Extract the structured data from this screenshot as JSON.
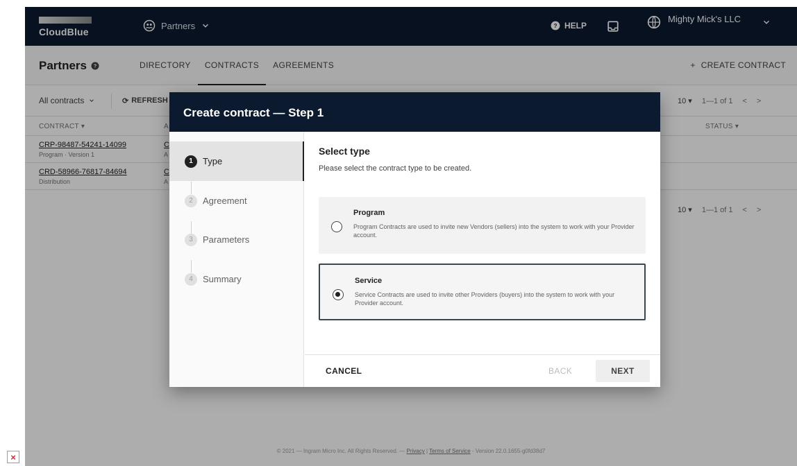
{
  "topbar": {
    "logo": "CloudBlue",
    "module": "Partners",
    "help": "HELP",
    "account": "Mighty Mick's LLC"
  },
  "subbar": {
    "title": "Partners",
    "tabs": [
      "DIRECTORY",
      "CONTRACTS",
      "AGREEMENTS"
    ],
    "active_tab": "CONTRACTS",
    "create": "CREATE CONTRACT"
  },
  "toolbar": {
    "filter": "All contracts",
    "refresh": "REFRESH",
    "page_size": "10",
    "range": "1—1 of 1"
  },
  "table": {
    "col_contract": "CONTRACT",
    "col_a": "A",
    "col_status": "STATUS",
    "rows": [
      {
        "id": "CRP-98487-54241-14099",
        "sub": "Program · Version 1",
        "c2": "C",
        "c2b": "A"
      },
      {
        "id": "CRD-58966-76817-84694",
        "sub": "Distribution",
        "c2": "C",
        "c2b": "A"
      }
    ]
  },
  "footer": {
    "pre": "© 2021 — Ingram Micro Inc. All Rights Reserved. — ",
    "privacy": "Privacy",
    "sep": " | ",
    "terms": "Terms of Service",
    "version": " - Version 22.0.1655-g0fd38d7"
  },
  "dialog": {
    "title": "Create contract — Step 1",
    "steps": [
      {
        "num": "1",
        "label": "Type"
      },
      {
        "num": "2",
        "label": "Agreement"
      },
      {
        "num": "3",
        "label": "Parameters"
      },
      {
        "num": "4",
        "label": "Summary"
      }
    ],
    "select_title": "Select type",
    "select_desc": "Please select the contract type to be created.",
    "options": [
      {
        "title": "Program",
        "desc": "Program Contracts are used to invite new Vendors (sellers) into the system to work with your Provider account.",
        "selected": false
      },
      {
        "title": "Service",
        "desc": "Service Contracts are used to invite other Providers (buyers) into the system to work with your Provider account.",
        "selected": true
      }
    ],
    "cancel": "CANCEL",
    "back": "BACK",
    "next": "NEXT"
  },
  "broken_image": "×"
}
